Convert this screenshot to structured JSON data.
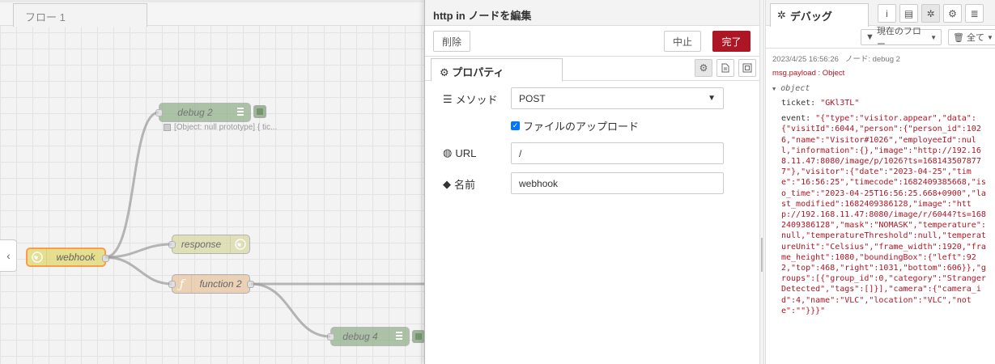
{
  "workspace": {
    "tab_label": "フロー 1",
    "nodes": {
      "debug2": "debug 2",
      "webhook": "webhook",
      "response": "response",
      "function2": "function 2",
      "debug4": "debug 4"
    },
    "debug2_status": "[Object: null prototype] { tic..."
  },
  "tray": {
    "title": "http in ノードを編集",
    "delete_label": "削除",
    "cancel_label": "中止",
    "done_label": "完了",
    "tab_properties": "プロパティ",
    "method_label": "メソッド",
    "method_value": "POST",
    "upload_label": "ファイルのアップロード",
    "url_label": "URL",
    "url_value": "/",
    "name_label": "名前",
    "name_value": "webhook"
  },
  "sidebar": {
    "tab_label": "デバッグ",
    "flow_filter": "現在のフロー",
    "clear_label": "全て",
    "message": {
      "timestamp": "2023/4/25 16:56:26",
      "node": "ノード: debug 2",
      "topic": "msg.payload : Object",
      "object_label": "object",
      "ticket_key": "ticket:",
      "ticket_value": "\"GKl3TL\"",
      "event_key": "event:",
      "event_value": "\"{\"type\":\"visitor.appear\",\"data\":{\"visitId\":6044,\"person\":{\"person_id\":1026,\"name\":\"Visitor#1026\",\"employeeId\":null,\"information\":{},\"image\":\"http://192.168.11.47:8080/image/p/1026?ts=1681435078777\"},\"visitor\":{\"date\":\"2023-04-25\",\"time\":\"16:56:25\",\"timecode\":1682409385668,\"iso_time\":\"2023-04-25T16:56:25.668+0900\",\"last_modified\":1682409386128,\"image\":\"http://192.168.11.47:8080/image/r/6044?ts=1682409386128\",\"mask\":\"NOMASK\",\"temperature\":null,\"temperatureThreshold\":null,\"temperatureUnit\":\"Celsius\",\"frame_width\":1920,\"frame_height\":1080,\"boundingBox\":{\"left\":922,\"top\":468,\"right\":1031,\"bottom\":606}},\"groups\":[{\"group_id\":0,\"category\":\"Stranger Detected\",\"tags\":[]}],\"camera\":{\"camera_id\":4,\"name\":\"VLC\",\"location\":\"VLC\",\"note\":\"\"}}}\""
    }
  },
  "colors": {
    "done_button": "#ad1625",
    "debug_node": "#87a980",
    "function_node": "#e9c8a3",
    "selected_border": "#ff7f0e"
  }
}
